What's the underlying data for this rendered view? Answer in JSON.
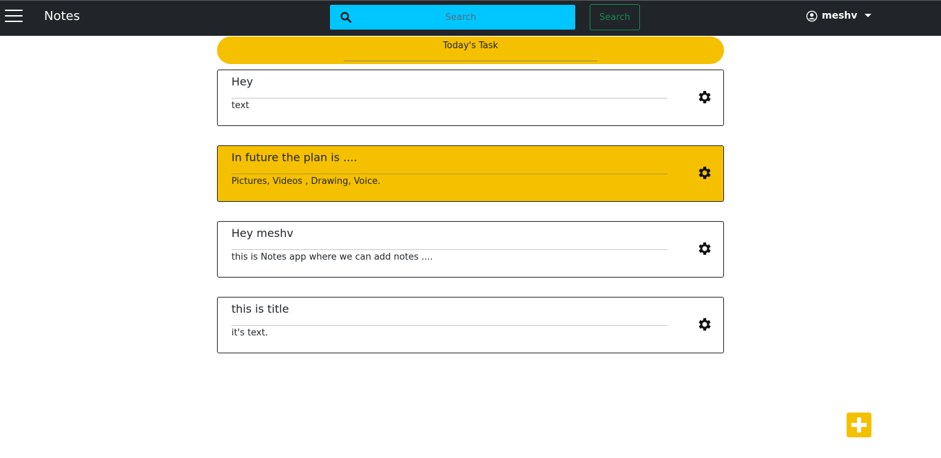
{
  "navbar": {
    "brand": "Notes",
    "search": {
      "placeholder": "Search",
      "button_label": "Search"
    },
    "user": {
      "name": "meshv"
    }
  },
  "today": {
    "label": "Today's Task"
  },
  "notes": [
    {
      "title": "Hey",
      "text": "text"
    },
    {
      "title": "In future the plan is ....",
      "text": "Pictures, Videos , Drawing, Voice."
    },
    {
      "title": "Hey meshv",
      "text": "this is Notes app where we can add notes ...."
    },
    {
      "title": "this is title",
      "text": "it's text."
    }
  ],
  "icons": {
    "menu": "hamburger-icon",
    "search": "search-icon",
    "user": "user-circle-icon",
    "settings": "gear-icon",
    "add": "plus-icon"
  },
  "colors": {
    "navbar": "#212529",
    "accent": "#f5c000",
    "search_bg": "#00c6ff",
    "search_button": "#198754"
  }
}
